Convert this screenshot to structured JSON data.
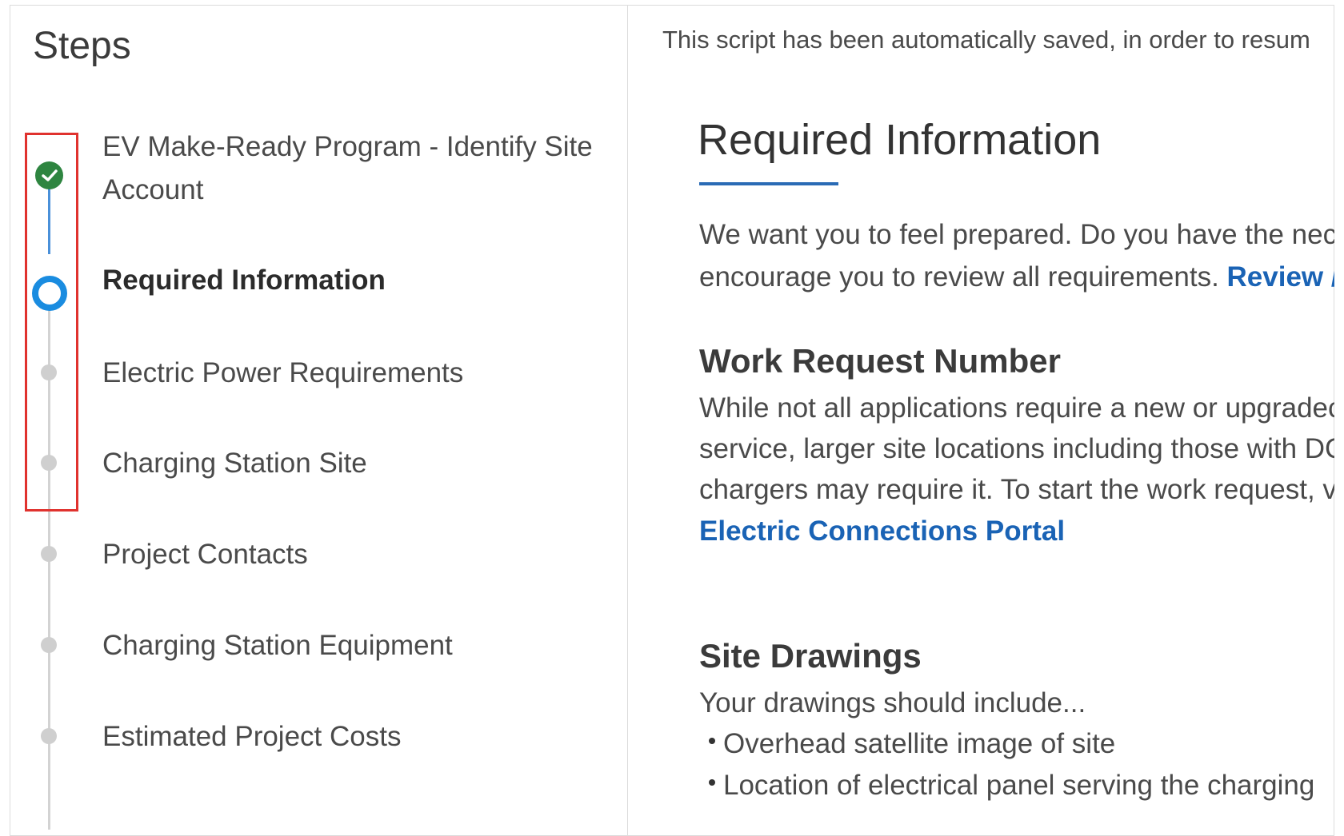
{
  "steps_panel": {
    "title": "Steps",
    "items": [
      {
        "label_line1": "EV Make-Ready Program - Identify Site",
        "label_line2": "Account",
        "status": "complete"
      },
      {
        "label": "Required Information",
        "status": "current"
      },
      {
        "label": "Electric Power Requirements",
        "status": "upcoming"
      },
      {
        "label": "Charging Station Site",
        "status": "upcoming"
      },
      {
        "label": "Project Contacts",
        "status": "upcoming"
      },
      {
        "label": "Charging Station Equipment",
        "status": "upcoming"
      },
      {
        "label": "Estimated Project Costs",
        "status": "upcoming"
      }
    ]
  },
  "main": {
    "autosave_notice": "This script has been automatically saved, in order to resum",
    "title": "Required Information",
    "intro_line1": "We want you to feel prepared. Do you have the nec",
    "intro_line2_text": "encourage you to review all requirements. ",
    "intro_link": "Review /",
    "work_request": {
      "heading": "Work Request Number",
      "line1": "While not all applications require a new or upgradec",
      "line2": "service, larger site locations including those with DC",
      "line3": "chargers may require it. To start the work request, v",
      "link": "Electric Connections Portal"
    },
    "site_drawings": {
      "heading": "Site Drawings",
      "intro": "Your drawings should include...",
      "bullets": [
        "Overhead satellite image of site",
        "Location of electrical panel serving the charging"
      ]
    }
  },
  "colors": {
    "complete": "#2e8540",
    "current": "#1a8ce0",
    "link": "#1a63b5",
    "highlight": "#e0322e"
  }
}
